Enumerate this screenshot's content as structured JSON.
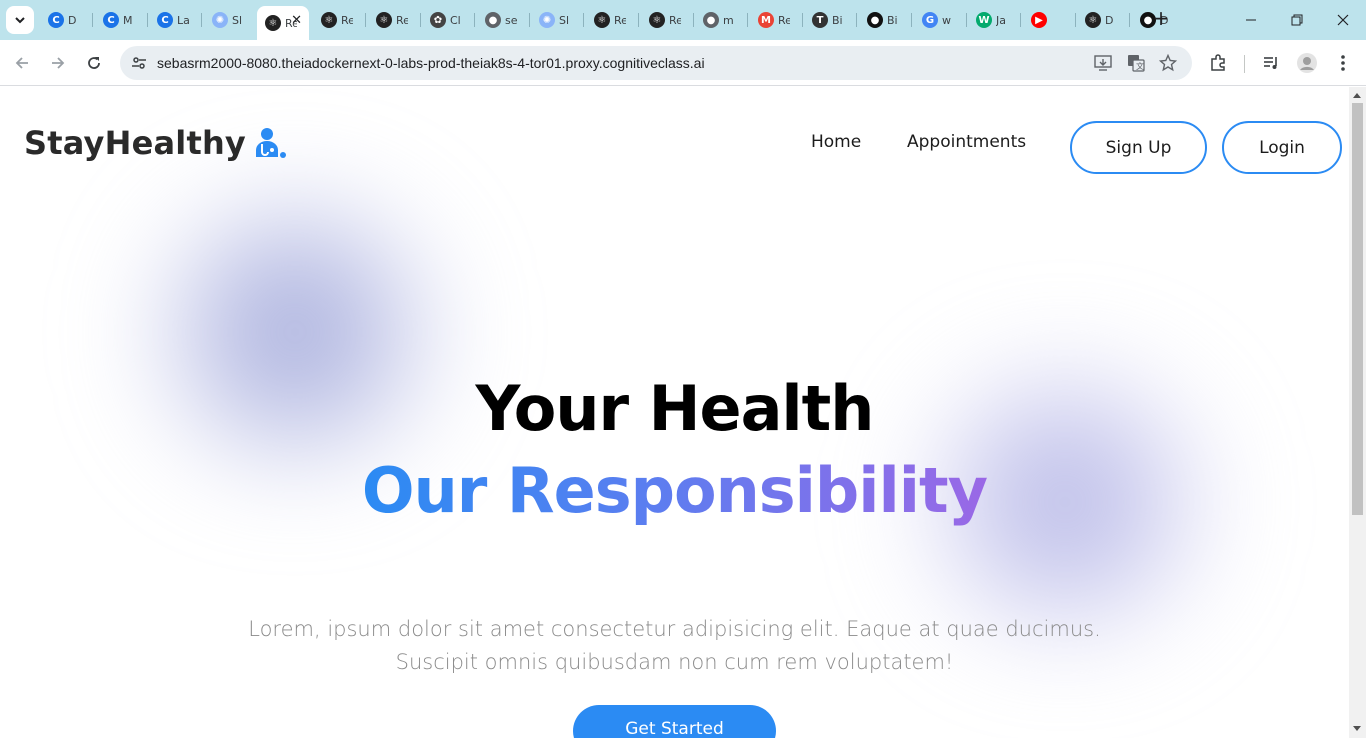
{
  "browser": {
    "tabs": [
      {
        "title": "D",
        "icon": "coursera-c-icon",
        "color": "#1a73e8"
      },
      {
        "title": "M",
        "icon": "coursera-c-icon",
        "color": "#1a73e8"
      },
      {
        "title": "La",
        "icon": "coursera-c-icon",
        "color": "#1a73e8"
      },
      {
        "title": "Sl",
        "icon": "openai-icon",
        "color": "#8ab4f8"
      },
      {
        "title": "Re",
        "icon": "react-icon",
        "color": "#222",
        "active": true
      },
      {
        "title": "Re",
        "icon": "react-icon",
        "color": "#222"
      },
      {
        "title": "Re",
        "icon": "react-icon",
        "color": "#222"
      },
      {
        "title": "Cl",
        "icon": "chatgpt-icon",
        "color": "#444"
      },
      {
        "title": "se",
        "icon": "globe-icon",
        "color": "#5f6368"
      },
      {
        "title": "Sl",
        "icon": "openai-icon",
        "color": "#8ab4f8"
      },
      {
        "title": "Re",
        "icon": "react-icon",
        "color": "#222"
      },
      {
        "title": "Re",
        "icon": "react-icon",
        "color": "#222"
      },
      {
        "title": "m",
        "icon": "globe-icon",
        "color": "#5f6368"
      },
      {
        "title": "Re",
        "icon": "gmail-icon",
        "color": "#ea4335"
      },
      {
        "title": "Bi",
        "icon": "text-icon",
        "color": "#333"
      },
      {
        "title": "Bi",
        "icon": "github-icon",
        "color": "#111"
      },
      {
        "title": "w",
        "icon": "google-icon",
        "color": "#4285f4"
      },
      {
        "title": "Ja",
        "icon": "w3-icon",
        "color": "#04aa6d"
      },
      {
        "title": "",
        "icon": "youtube-icon",
        "color": "#ff0000"
      },
      {
        "title": "D",
        "icon": "react-icon",
        "color": "#222"
      },
      {
        "title": "D",
        "icon": "github-icon",
        "color": "#111"
      }
    ],
    "close_tab_glyph": "✕",
    "new_tab_glyph": "+",
    "url": "sebasrm2000-8080.theiadockernext-0-labs-prod-theiak8s-4-tor01.proxy.cognitiveclass.ai"
  },
  "site": {
    "logo_text": "StayHealthy",
    "nav": {
      "home": "Home",
      "appointments": "Appointments"
    },
    "signup_label": "Sign Up",
    "login_label": "Login",
    "hero_title_line1": "Your Health",
    "hero_title_line2": "Our Responsibility",
    "hero_desc_line1": "Lorem, ipsum dolor sit amet consectetur adipisicing elit. Eaque at quae ducimus.",
    "hero_desc_line2": "Suscipit omnis quibusdam non cum rem voluptatem!",
    "cta_label": "Get Started",
    "colors": {
      "accent": "#2b8bf3",
      "gradient_end": "#9a68e6",
      "text_muted": "#8a8a8a"
    }
  }
}
